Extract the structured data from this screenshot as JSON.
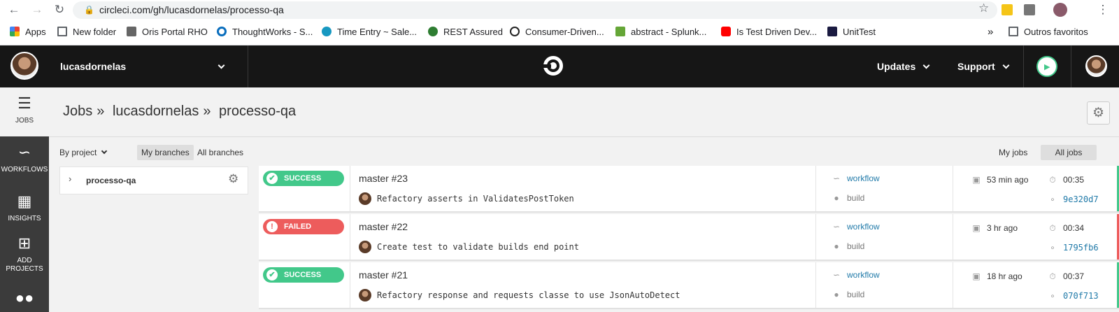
{
  "browser": {
    "url": "circleci.com/gh/lucasdornelas/processo-qa",
    "bookmarks": [
      "Apps",
      "New folder",
      "Oris Portal RHO",
      "ThoughtWorks - S...",
      "Time Entry ~ Sale...",
      "REST Assured",
      "Consumer-Driven...",
      "abstract - Splunk...",
      "Is Test Driven Dev...",
      "UnitTest"
    ],
    "overflow": "»",
    "other_bookmarks": "Outros favoritos"
  },
  "header": {
    "username": "lucasdornelas",
    "updates": "Updates",
    "support": "Support"
  },
  "sidebar": {
    "items": [
      {
        "label": "JOBS",
        "icon": "jobs-icon"
      },
      {
        "label": "WORKFLOWS",
        "icon": "workflows-icon"
      },
      {
        "label": "INSIGHTS",
        "icon": "insights-icon"
      },
      {
        "label": "ADD PROJECTS",
        "icon": "add-projects-icon"
      }
    ]
  },
  "breadcrumb": {
    "root": "Jobs",
    "sep": "»",
    "org": "lucasdornelas",
    "project": "processo-qa"
  },
  "filters": {
    "by_project": "By project",
    "my_branches": "My branches",
    "all_branches": "All branches",
    "my_jobs": "My jobs",
    "all_jobs": "All jobs"
  },
  "projects": [
    {
      "name": "processo-qa"
    }
  ],
  "colors": {
    "success": "#42c88a",
    "failed": "#ed5c5c",
    "link": "#1f79a8",
    "header": "#161616",
    "sidebar": "#3b3b3b"
  },
  "jobs": [
    {
      "status": "SUCCESS",
      "title": "master #23",
      "commit": "Refactory asserts in ValidatesPostToken",
      "workflow": "workflow",
      "job": "build",
      "time": "53 min ago",
      "duration": "00:35",
      "hash": "9e320d7"
    },
    {
      "status": "FAILED",
      "title": "master #22",
      "commit": "Create test to validate builds end point",
      "workflow": "workflow",
      "job": "build",
      "time": "3 hr ago",
      "duration": "00:34",
      "hash": "1795fb6"
    },
    {
      "status": "SUCCESS",
      "title": "master #21",
      "commit": "Refactory response and requests classe to use JsonAutoDetect",
      "workflow": "workflow",
      "job": "build",
      "time": "18 hr ago",
      "duration": "00:37",
      "hash": "070f713"
    }
  ]
}
